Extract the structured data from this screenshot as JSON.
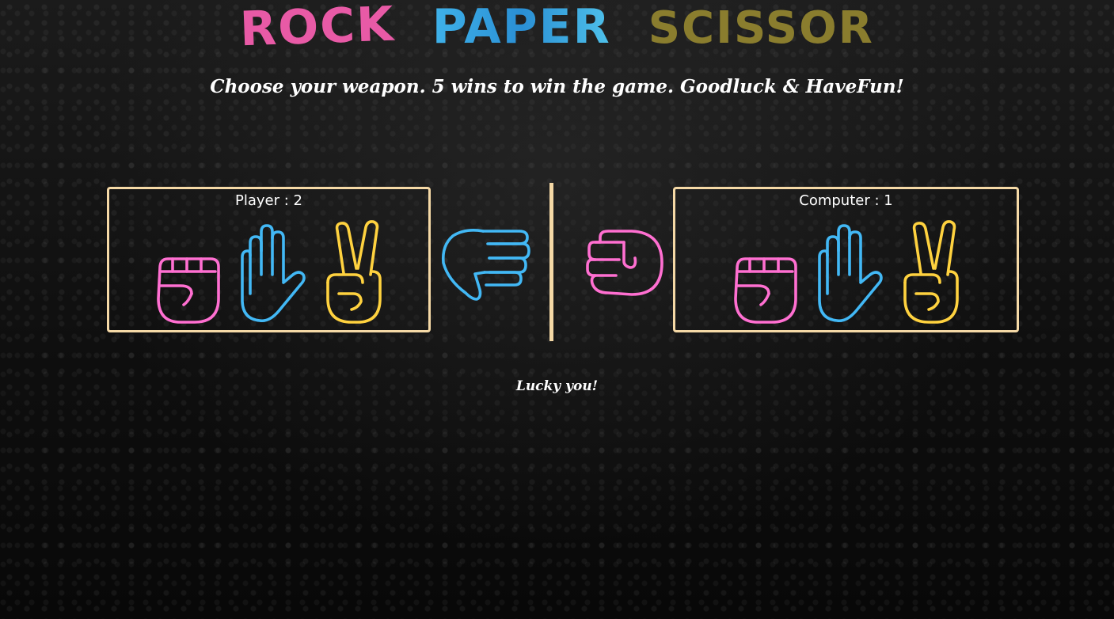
{
  "title": {
    "word1": "ROCK",
    "word2": "PAPER",
    "word3": "SCISSOR"
  },
  "subtitle": "Choose your weapon. 5 wins to win the game. Goodluck & HaveFun!",
  "player": {
    "label": "Player : 2",
    "weapons": [
      "rock-icon",
      "paper-icon",
      "scissor-icon"
    ],
    "chosen": "paper-icon"
  },
  "computer": {
    "label": "Computer : 1",
    "weapons": [
      "rock-icon",
      "paper-icon",
      "scissor-icon"
    ],
    "chosen": "rock-icon"
  },
  "result": "Lucky you!",
  "colors": {
    "rock": "#ff6fd1",
    "paper": "#42b8f5",
    "scissor": "#ffd23f",
    "panel_border": "#f5d9a6"
  }
}
